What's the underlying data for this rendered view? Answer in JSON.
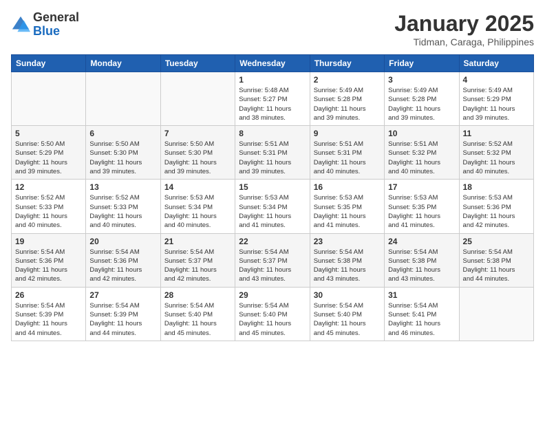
{
  "header": {
    "logo_general": "General",
    "logo_blue": "Blue",
    "month_year": "January 2025",
    "location": "Tidman, Caraga, Philippines"
  },
  "weekdays": [
    "Sunday",
    "Monday",
    "Tuesday",
    "Wednesday",
    "Thursday",
    "Friday",
    "Saturday"
  ],
  "weeks": [
    [
      {
        "day": "",
        "info": ""
      },
      {
        "day": "",
        "info": ""
      },
      {
        "day": "",
        "info": ""
      },
      {
        "day": "1",
        "info": "Sunrise: 5:48 AM\nSunset: 5:27 PM\nDaylight: 11 hours\nand 38 minutes."
      },
      {
        "day": "2",
        "info": "Sunrise: 5:49 AM\nSunset: 5:28 PM\nDaylight: 11 hours\nand 39 minutes."
      },
      {
        "day": "3",
        "info": "Sunrise: 5:49 AM\nSunset: 5:28 PM\nDaylight: 11 hours\nand 39 minutes."
      },
      {
        "day": "4",
        "info": "Sunrise: 5:49 AM\nSunset: 5:29 PM\nDaylight: 11 hours\nand 39 minutes."
      }
    ],
    [
      {
        "day": "5",
        "info": "Sunrise: 5:50 AM\nSunset: 5:29 PM\nDaylight: 11 hours\nand 39 minutes."
      },
      {
        "day": "6",
        "info": "Sunrise: 5:50 AM\nSunset: 5:30 PM\nDaylight: 11 hours\nand 39 minutes."
      },
      {
        "day": "7",
        "info": "Sunrise: 5:50 AM\nSunset: 5:30 PM\nDaylight: 11 hours\nand 39 minutes."
      },
      {
        "day": "8",
        "info": "Sunrise: 5:51 AM\nSunset: 5:31 PM\nDaylight: 11 hours\nand 39 minutes."
      },
      {
        "day": "9",
        "info": "Sunrise: 5:51 AM\nSunset: 5:31 PM\nDaylight: 11 hours\nand 40 minutes."
      },
      {
        "day": "10",
        "info": "Sunrise: 5:51 AM\nSunset: 5:32 PM\nDaylight: 11 hours\nand 40 minutes."
      },
      {
        "day": "11",
        "info": "Sunrise: 5:52 AM\nSunset: 5:32 PM\nDaylight: 11 hours\nand 40 minutes."
      }
    ],
    [
      {
        "day": "12",
        "info": "Sunrise: 5:52 AM\nSunset: 5:33 PM\nDaylight: 11 hours\nand 40 minutes."
      },
      {
        "day": "13",
        "info": "Sunrise: 5:52 AM\nSunset: 5:33 PM\nDaylight: 11 hours\nand 40 minutes."
      },
      {
        "day": "14",
        "info": "Sunrise: 5:53 AM\nSunset: 5:34 PM\nDaylight: 11 hours\nand 40 minutes."
      },
      {
        "day": "15",
        "info": "Sunrise: 5:53 AM\nSunset: 5:34 PM\nDaylight: 11 hours\nand 41 minutes."
      },
      {
        "day": "16",
        "info": "Sunrise: 5:53 AM\nSunset: 5:35 PM\nDaylight: 11 hours\nand 41 minutes."
      },
      {
        "day": "17",
        "info": "Sunrise: 5:53 AM\nSunset: 5:35 PM\nDaylight: 11 hours\nand 41 minutes."
      },
      {
        "day": "18",
        "info": "Sunrise: 5:53 AM\nSunset: 5:36 PM\nDaylight: 11 hours\nand 42 minutes."
      }
    ],
    [
      {
        "day": "19",
        "info": "Sunrise: 5:54 AM\nSunset: 5:36 PM\nDaylight: 11 hours\nand 42 minutes."
      },
      {
        "day": "20",
        "info": "Sunrise: 5:54 AM\nSunset: 5:36 PM\nDaylight: 11 hours\nand 42 minutes."
      },
      {
        "day": "21",
        "info": "Sunrise: 5:54 AM\nSunset: 5:37 PM\nDaylight: 11 hours\nand 42 minutes."
      },
      {
        "day": "22",
        "info": "Sunrise: 5:54 AM\nSunset: 5:37 PM\nDaylight: 11 hours\nand 43 minutes."
      },
      {
        "day": "23",
        "info": "Sunrise: 5:54 AM\nSunset: 5:38 PM\nDaylight: 11 hours\nand 43 minutes."
      },
      {
        "day": "24",
        "info": "Sunrise: 5:54 AM\nSunset: 5:38 PM\nDaylight: 11 hours\nand 43 minutes."
      },
      {
        "day": "25",
        "info": "Sunrise: 5:54 AM\nSunset: 5:38 PM\nDaylight: 11 hours\nand 44 minutes."
      }
    ],
    [
      {
        "day": "26",
        "info": "Sunrise: 5:54 AM\nSunset: 5:39 PM\nDaylight: 11 hours\nand 44 minutes."
      },
      {
        "day": "27",
        "info": "Sunrise: 5:54 AM\nSunset: 5:39 PM\nDaylight: 11 hours\nand 44 minutes."
      },
      {
        "day": "28",
        "info": "Sunrise: 5:54 AM\nSunset: 5:40 PM\nDaylight: 11 hours\nand 45 minutes."
      },
      {
        "day": "29",
        "info": "Sunrise: 5:54 AM\nSunset: 5:40 PM\nDaylight: 11 hours\nand 45 minutes."
      },
      {
        "day": "30",
        "info": "Sunrise: 5:54 AM\nSunset: 5:40 PM\nDaylight: 11 hours\nand 45 minutes."
      },
      {
        "day": "31",
        "info": "Sunrise: 5:54 AM\nSunset: 5:41 PM\nDaylight: 11 hours\nand 46 minutes."
      },
      {
        "day": "",
        "info": ""
      }
    ]
  ]
}
